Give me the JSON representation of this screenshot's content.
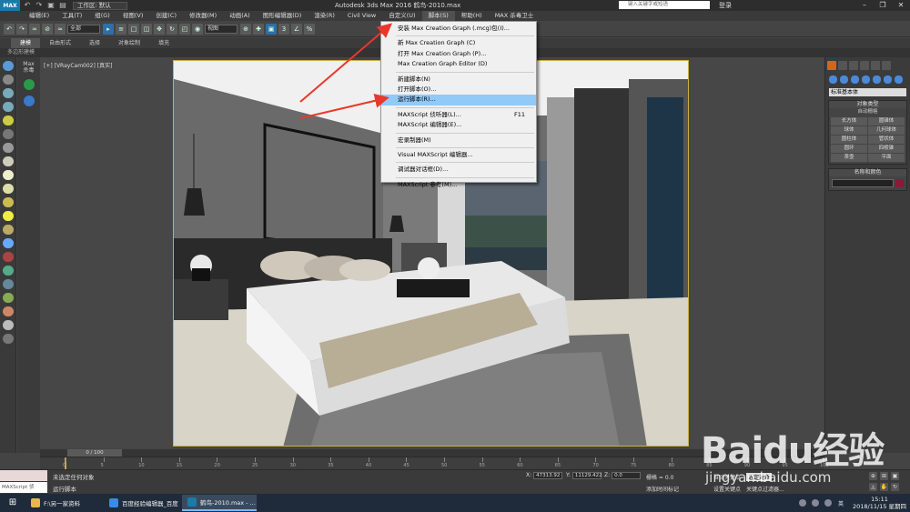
{
  "window": {
    "app_logo": "MAX",
    "workspace": "工作区: 默认",
    "title": "Autodesk 3ds Max 2016      鹤鸟-2010.max",
    "search_placeholder": "键入关键字或短语",
    "login": "登录"
  },
  "menubar": {
    "items": [
      "编辑(E)",
      "工具(T)",
      "组(G)",
      "视图(V)",
      "创建(C)",
      "修改器(M)",
      "动画(A)",
      "图形编辑器(D)",
      "渲染(R)",
      "Civil View",
      "自定义(U)",
      "脚本(S)",
      "帮助(H)",
      "MAX 杀毒卫士"
    ]
  },
  "toolbar": {
    "selection_filter": "全部",
    "ref_coord": "视图"
  },
  "ribbon": {
    "tabs": [
      "建模",
      "自由形式",
      "选择",
      "对象绘制",
      "填充"
    ],
    "sub_label": "多边形建模"
  },
  "scene_panel": {
    "label_line1": "Max",
    "label_line2": "杀毒"
  },
  "viewport": {
    "label": "[+] [VRayCam002] [真实]"
  },
  "script_menu": {
    "items": [
      {
        "label": "安装 Max Creation Graph (.mcg)包(I)...",
        "shortcut": ""
      },
      {
        "sep": true
      },
      {
        "label": "新 Max Creation Graph (C)",
        "shortcut": ""
      },
      {
        "label": "打开 Max Creation Graph (P)...",
        "shortcut": ""
      },
      {
        "label": "Max Creation Graph Editor (D)",
        "shortcut": ""
      },
      {
        "sep": true
      },
      {
        "label": "新建脚本(N)",
        "shortcut": ""
      },
      {
        "label": "打开脚本(O)...",
        "shortcut": ""
      },
      {
        "label": "运行脚本(R)...",
        "shortcut": "",
        "highlight": true
      },
      {
        "sep": true
      },
      {
        "label": "MAXScript 侦听器(L)...",
        "shortcut": "F11"
      },
      {
        "label": "MAXScript 编辑器(E)...",
        "shortcut": ""
      },
      {
        "sep": true
      },
      {
        "label": "宏录制器(M)",
        "shortcut": ""
      },
      {
        "sep": true
      },
      {
        "label": "Visual MAXScript 编辑器...",
        "shortcut": ""
      },
      {
        "sep": true
      },
      {
        "label": "调试器对话框(D)...",
        "shortcut": ""
      },
      {
        "sep": true
      },
      {
        "label": "MAXScript 参考(M)...",
        "shortcut": ""
      }
    ]
  },
  "command_panel": {
    "category": "标准基本体",
    "object_type_title": "对象类型",
    "autogrid": "自动栅格",
    "object_buttons": [
      "长方体",
      "圆锥体",
      "球体",
      "几何球体",
      "圆柱体",
      "管状体",
      "圆环",
      "四棱锥",
      "茶壶",
      "平面"
    ],
    "name_color_title": "名称和颜色"
  },
  "timeline": {
    "slider": "0 / 100",
    "ticks": [
      "0",
      "5",
      "10",
      "15",
      "20",
      "25",
      "30",
      "35",
      "40",
      "45",
      "50",
      "55",
      "60",
      "65",
      "70",
      "75",
      "80",
      "85",
      "90",
      "95",
      "100"
    ]
  },
  "status": {
    "maxscript_label": "MAXScript 侦",
    "selection_msg": "未选定任何对象",
    "prompt_msg": "运行脚本",
    "x_label": "X:",
    "x_value": "47313.92",
    "y_label": "Y:",
    "y_value": "11129.422",
    "z_label": "Z:",
    "z_value": "0.0",
    "grid": "栅格 = 0.0",
    "add_time_tag": "添加时间标记",
    "auto_key": "自动关键点",
    "selected": "选定对象",
    "set_key": "设置关键点",
    "key_filter": "关键点过滤器..."
  },
  "taskbar": {
    "items": [
      "F:\\另一家资料",
      "百度经验编辑器_百度经...",
      "鹤鸟-2010.max - ..."
    ],
    "ime": "英",
    "time": "15:11",
    "date": "2018/11/15 星期四"
  },
  "watermark": {
    "brand": "Baidu经验",
    "url": "jingyan.baidu.com"
  },
  "colors": {
    "viewport_border": "#c8b040",
    "menu_highlight": "#91c9f7",
    "arrow": "#e8382b",
    "active_tab": "#d0661f"
  }
}
